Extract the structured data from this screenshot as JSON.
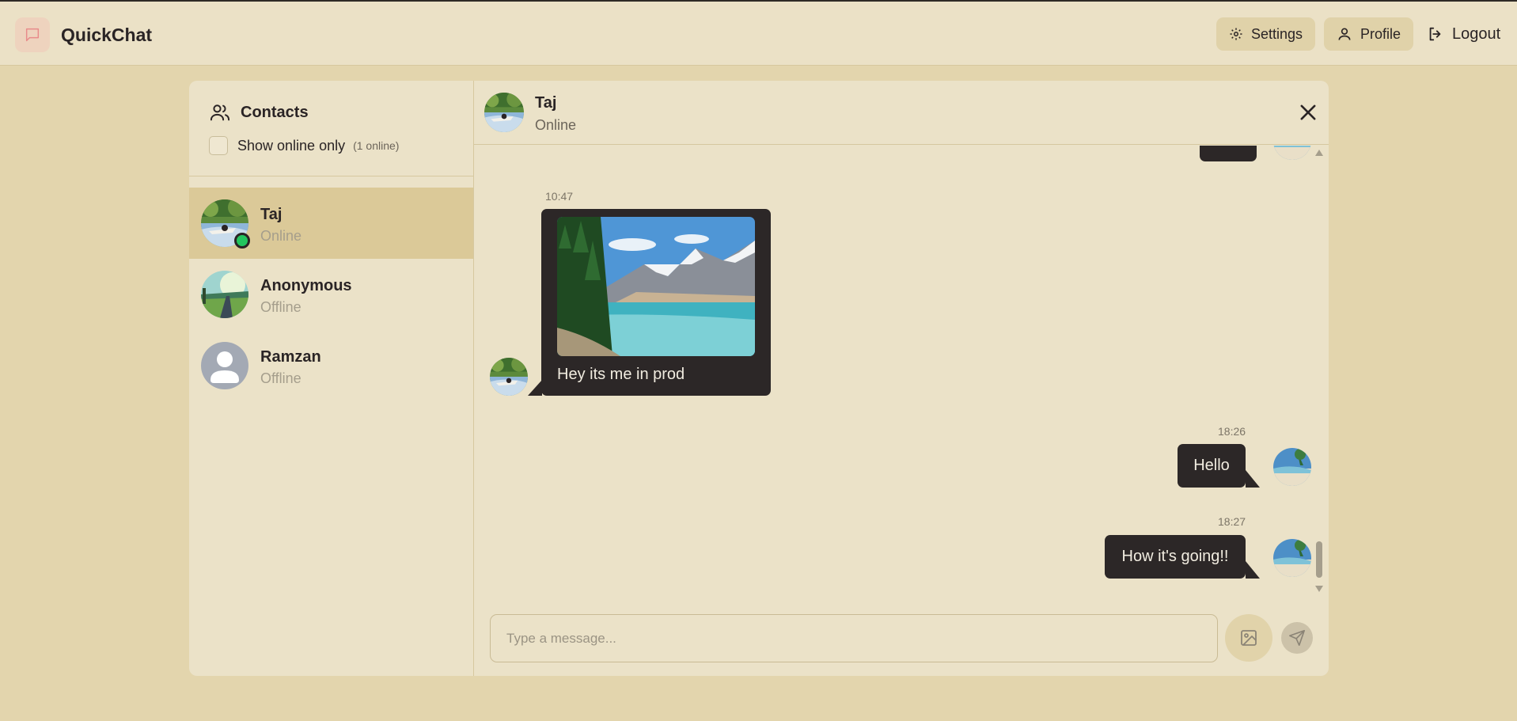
{
  "app": {
    "name": "QuickChat"
  },
  "nav": {
    "settings_label": "Settings",
    "profile_label": "Profile",
    "logout_label": "Logout"
  },
  "sidebar": {
    "title": "Contacts",
    "filter_label": "Show online only",
    "online_count": "(1 online)",
    "filter_checked": false,
    "contacts": [
      {
        "name": "Taj",
        "status": "Online",
        "active": true,
        "avatar": "lake-kayak-avatar"
      },
      {
        "name": "Anonymous",
        "status": "Offline",
        "active": false,
        "avatar": "road-landscape-avatar"
      },
      {
        "name": "Ramzan",
        "status": "Offline",
        "active": false,
        "avatar": "default-user-avatar"
      }
    ]
  },
  "chat": {
    "contact_name": "Taj",
    "contact_status": "Online",
    "messages": [
      {
        "from": "contact",
        "time": "10:47",
        "text": "Hey its me in prod",
        "image": "mountain-lake-photo"
      },
      {
        "from": "me",
        "time": "18:26",
        "text": "Hello"
      },
      {
        "from": "me",
        "time": "18:27",
        "text": "How it's going!!"
      }
    ]
  },
  "composer": {
    "placeholder": "Type a message..."
  },
  "colors": {
    "background": "#e3d5ad",
    "panel": "#ebe2c8",
    "active_contact": "#dbc998",
    "bubble": "#2c2727",
    "online": "#23c55e"
  }
}
